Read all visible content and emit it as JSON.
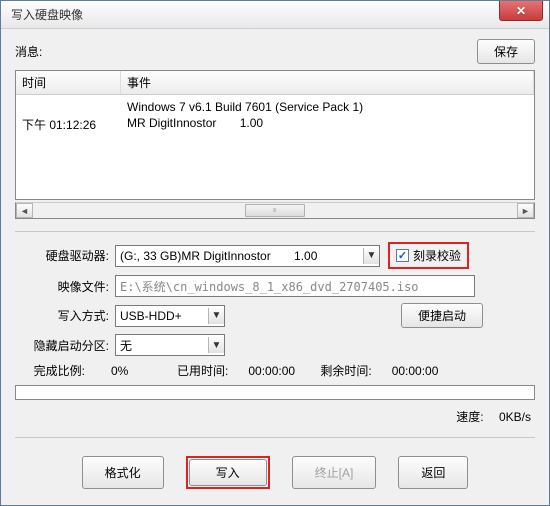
{
  "window": {
    "title": "写入硬盘映像"
  },
  "topbar": {
    "msg_label": "消息:",
    "save_btn": "保存"
  },
  "log": {
    "headers": {
      "time": "时间",
      "event": "事件"
    },
    "rows": [
      {
        "time": "",
        "event": "Windows 7 v6.1 Build 7601 (Service Pack 1)"
      },
      {
        "time": "下午 01:12:26",
        "event": "MR DigitInnostor       1.00"
      }
    ]
  },
  "form": {
    "drive_label": "硬盘驱动器:",
    "drive_value": "(G:, 33 GB)MR DigitInnostor       1.00",
    "verify_label": "刻录校验",
    "verify_checked": "✓",
    "image_label": "映像文件:",
    "image_value": "E:\\系统\\cn_windows_8_1_x86_dvd_2707405.iso",
    "method_label": "写入方式:",
    "method_value": "USB-HDD+",
    "quickboot_btn": "便捷启动",
    "hidden_label": "隐藏启动分区:",
    "hidden_value": "无"
  },
  "progress": {
    "ratio_label": "完成比例:",
    "ratio_value": "0%",
    "elapsed_label": "已用时间:",
    "elapsed_value": "00:00:00",
    "remain_label": "剩余时间:",
    "remain_value": "00:00:00",
    "speed_label": "速度:",
    "speed_value": "0KB/s"
  },
  "buttons": {
    "format": "格式化",
    "write": "写入",
    "abort": "终止[A]",
    "back": "返回"
  }
}
